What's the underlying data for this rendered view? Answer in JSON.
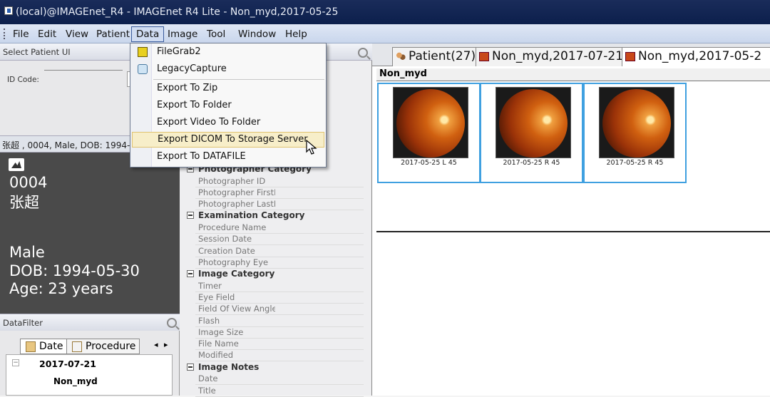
{
  "window": {
    "title": "(local)@IMAGEnet_R4 - IMAGEnet R4 Lite - Non_myd,2017-05-25"
  },
  "menubar": {
    "items": [
      "File",
      "Edit",
      "View",
      "Patient",
      "Data",
      "Image",
      "Tool",
      "Window",
      "Help"
    ],
    "active": "Data"
  },
  "data_menu": {
    "items": [
      {
        "label": "FileGrab2",
        "icon": "filegrab-icon"
      },
      {
        "label": "LegacyCapture",
        "icon": "legacy-capture-icon"
      },
      {
        "label": "Export To Zip"
      },
      {
        "label": "Export To Folder"
      },
      {
        "label": "Export Video To Folder"
      },
      {
        "label": "Export DICOM To Storage Server",
        "highlighted": true
      },
      {
        "label": "Export To DATAFILE"
      }
    ]
  },
  "select_patient": {
    "header": "Select Patient UI",
    "id_code_label": "ID Code:"
  },
  "patient": {
    "summary": "张超 , 0004, Male, DOB: 1994-",
    "id": "0004",
    "name": "张超",
    "sex": "Male",
    "dob": "DOB: 1994-05-30",
    "age": "Age: 23 years"
  },
  "data_filter": {
    "header": "DataFilter",
    "tabs": [
      "Date",
      "Procedure"
    ],
    "rows": [
      {
        "text": "2017-07-21"
      },
      {
        "text": "Non_myd"
      }
    ]
  },
  "properties": {
    "categories": [
      {
        "name": "Photographer Category",
        "fields": [
          "Photographer ID",
          "Photographer FirstN",
          "Photographer LastN"
        ]
      },
      {
        "name": "Examination Category",
        "fields": [
          "Procedure Name",
          "Session Date",
          "Creation Date",
          "Photography Eye"
        ]
      },
      {
        "name": "Image Category",
        "fields": [
          "Timer",
          "Eye Field",
          "Field Of View Angle",
          "Flash",
          "Image Size",
          "File Name",
          "Modified"
        ]
      },
      {
        "name": "Image Notes",
        "fields": [
          "Date",
          "Title"
        ]
      }
    ]
  },
  "viewer": {
    "tabs": [
      {
        "label": "Patient(27)",
        "icon": "patients-icon"
      },
      {
        "label": "Non_myd,2017-07-21",
        "icon": "image-tab-icon"
      },
      {
        "label": "Non_myd,2017-05-2",
        "icon": "image-tab-icon"
      }
    ],
    "session_label": "Non_myd",
    "thumbnails": [
      {
        "caption": "2017-05-25 L 45"
      },
      {
        "caption": "2017-05-25 R 45"
      },
      {
        "caption": "2017-05-25 R 45"
      }
    ]
  },
  "colors": {
    "title_bar": "#0c1f4c",
    "menu_highlight": "#f7eec9",
    "thumbnail_border": "#3fa0e0",
    "patient_card": "#4a4a4a"
  }
}
